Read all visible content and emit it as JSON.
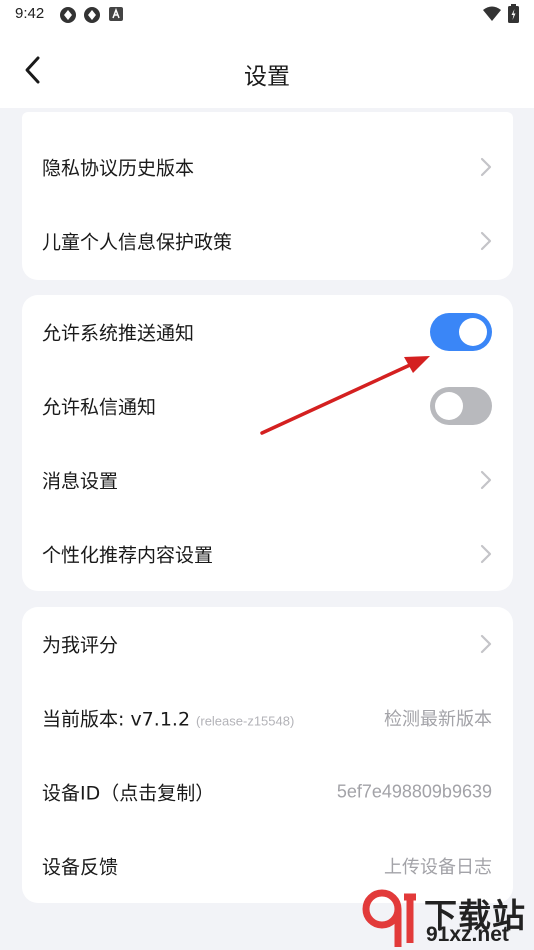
{
  "status_bar": {
    "time": "9:42",
    "icons": [
      "app-notification-icon",
      "app-notification-icon",
      "a-badge-icon",
      "wifi-icon",
      "battery-icon"
    ]
  },
  "header": {
    "title": "设置",
    "back_icon": "back-arrow-icon"
  },
  "card1": {
    "items": [
      {
        "label": "隐私协议历史版本",
        "icon": "chevron-right-icon"
      },
      {
        "label": "儿童个人信息保护政策",
        "icon": "chevron-right-icon"
      }
    ]
  },
  "card2": {
    "items": [
      {
        "label": "允许系统推送通知",
        "toggle": true
      },
      {
        "label": "允许私信通知",
        "toggle": false
      },
      {
        "label": "消息设置",
        "icon": "chevron-right-icon"
      },
      {
        "label": "个性化推荐内容设置",
        "icon": "chevron-right-icon"
      }
    ]
  },
  "card3": {
    "items": [
      {
        "label": "为我评分",
        "icon": "chevron-right-icon"
      },
      {
        "label": "当前版本: v7.1.2",
        "sub": "(release-z15548)",
        "value": "检测最新版本"
      },
      {
        "label": "设备ID（点击复制）",
        "value": "5ef7e498809b9639"
      },
      {
        "label": "设备反馈",
        "value": "上传设备日志"
      }
    ]
  },
  "watermark": {
    "text": "下载站",
    "url": "91xz.net"
  },
  "colors": {
    "accent": "#3a86f7",
    "toggle_off": "#b8b9bd",
    "annotation_arrow": "#d42020",
    "background": "#f2f3f7"
  }
}
